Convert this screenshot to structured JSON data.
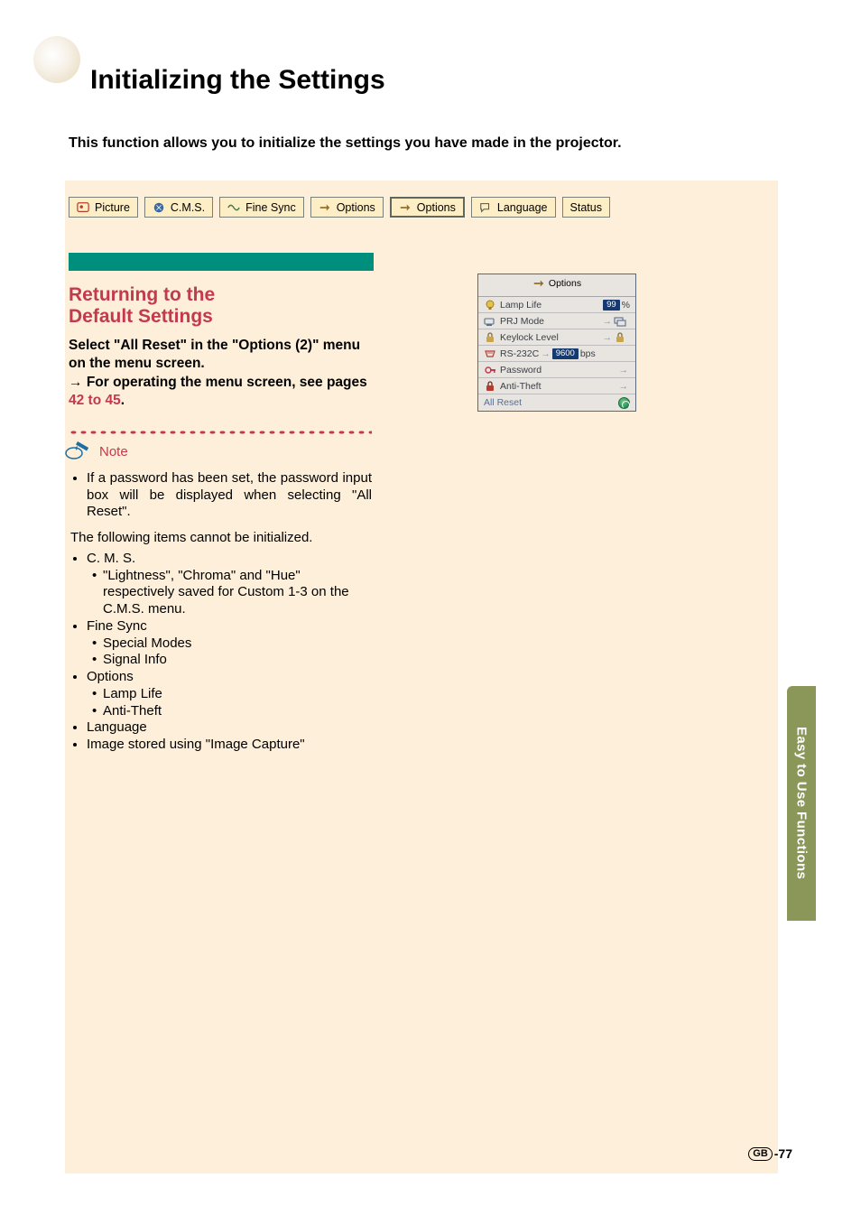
{
  "title": "Initializing the Settings",
  "intro": "This function allows you to initialize the settings you have made in the projector.",
  "side_tab": "Easy to Use Functions",
  "tabs": {
    "picture": "Picture",
    "cms": "C.M.S.",
    "finesync": "Fine Sync",
    "options1": "Options",
    "options2": "Options",
    "language": "Language",
    "status": "Status"
  },
  "section": {
    "title_l1": "Returning to the",
    "title_l2": "Default Settings",
    "instr_main": "Select \"All Reset\" in the \"Options (2)\" menu on the menu screen.",
    "instr_cont": "For operating the menu screen, see pages ",
    "instr_link": "42 to 45",
    "instr_period": "."
  },
  "note": {
    "label": "Note",
    "password": "If a password has been set, the password input box will be displayed when selecting \"All Reset\".",
    "following": "The following items cannot be initialized.",
    "cms": "C. M. S.",
    "cms_sub": "\"Lightness\", \"Chroma\" and \"Hue\" respectively saved for Custom 1-3 on the C.M.S. menu.",
    "finesync": "Fine Sync",
    "fs_sm": "Special Modes",
    "fs_si": "Signal Info",
    "options": "Options",
    "op_ll": "Lamp Life",
    "op_at": "Anti-Theft",
    "language": "Language",
    "imgcap": "Image stored using \"Image Capture\""
  },
  "osd": {
    "title": "Options",
    "rows": {
      "lamplife": {
        "label": "Lamp Life",
        "value": "99",
        "unit": "%"
      },
      "prjmode": {
        "label": "PRJ Mode"
      },
      "keylock": {
        "label": "Keylock Level"
      },
      "rs232c": {
        "label": "RS-232C",
        "value": "9600",
        "unit": "bps"
      },
      "password": {
        "label": "Password"
      },
      "antitheft": {
        "label": "Anti-Theft"
      },
      "allreset": {
        "label": "All Reset"
      }
    }
  },
  "footer": {
    "gb": "GB",
    "pn": "-77"
  }
}
